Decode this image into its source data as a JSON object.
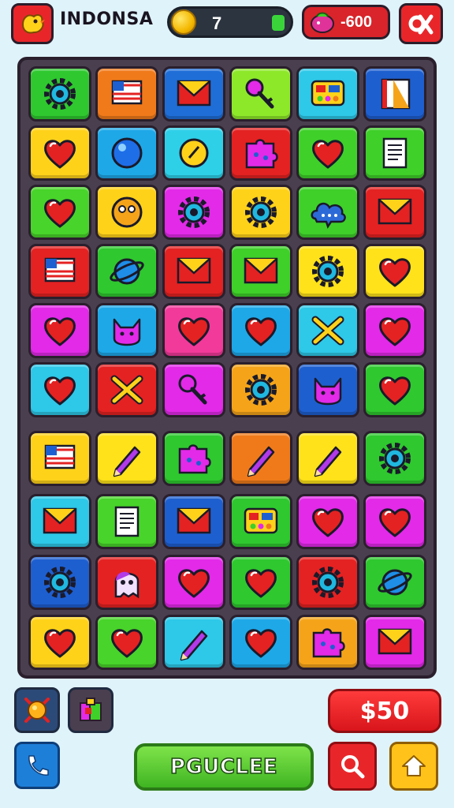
{
  "header": {
    "title": "INDONSA",
    "coins": "7",
    "cash": "-600",
    "logo_icon": "bird-icon",
    "close_icon": "close-icon"
  },
  "board": {
    "rows": [
      [
        {
          "color": "#2fc82f",
          "icon": "gear"
        },
        {
          "color": "#f07a1a",
          "icon": "flag"
        },
        {
          "color": "#1f6ed8",
          "icon": "envelope"
        },
        {
          "color": "#8ee82a",
          "icon": "key"
        },
        {
          "color": "#2ec8e8",
          "icon": "palette"
        },
        {
          "color": "#1e5fd0",
          "icon": "flag-stripe"
        }
      ],
      [
        {
          "color": "#ffd21a",
          "icon": "heart"
        },
        {
          "color": "#1ea8e8",
          "icon": "ball"
        },
        {
          "color": "#2ed0e8",
          "icon": "coin"
        },
        {
          "color": "#e42222",
          "icon": "puzzle"
        },
        {
          "color": "#3fd02a",
          "icon": "heart"
        },
        {
          "color": "#3fd02a",
          "icon": "document"
        }
      ],
      [
        {
          "color": "#48d42a",
          "icon": "heart"
        },
        {
          "color": "#ffd21a",
          "icon": "face"
        },
        {
          "color": "#e22ae8",
          "icon": "gear"
        },
        {
          "color": "#ffd21a",
          "icon": "gear"
        },
        {
          "color": "#3fd02a",
          "icon": "cloud"
        },
        {
          "color": "#e42222",
          "icon": "envelope"
        }
      ],
      [
        {
          "color": "#e42222",
          "icon": "flag"
        },
        {
          "color": "#2fc82f",
          "icon": "planet"
        },
        {
          "color": "#e42222",
          "icon": "envelope"
        },
        {
          "color": "#3fd02a",
          "icon": "envelope"
        },
        {
          "color": "#ffe21a",
          "icon": "gear"
        },
        {
          "color": "#ffe21a",
          "icon": "heart"
        }
      ],
      [
        {
          "color": "#e22ae8",
          "icon": "heart"
        },
        {
          "color": "#1ea8e8",
          "icon": "cat"
        },
        {
          "color": "#f23a9a",
          "icon": "heart"
        },
        {
          "color": "#1ea8e8",
          "icon": "heart"
        },
        {
          "color": "#2ec8e8",
          "icon": "cross"
        },
        {
          "color": "#e22ae8",
          "icon": "heart"
        }
      ],
      [
        {
          "color": "#2ec8e8",
          "icon": "heart"
        },
        {
          "color": "#e42222",
          "icon": "cross"
        },
        {
          "color": "#e22ae8",
          "icon": "key"
        },
        {
          "color": "#f5a41a",
          "icon": "gear"
        },
        {
          "color": "#1e5fd0",
          "icon": "cat"
        },
        {
          "color": "#2fc82f",
          "icon": "heart"
        }
      ],
      [
        {
          "color": "#ffd21a",
          "icon": "flag"
        },
        {
          "color": "#ffe21a",
          "icon": "pencil"
        },
        {
          "color": "#2fc82f",
          "icon": "puzzle"
        },
        {
          "color": "#f07a1a",
          "icon": "pencil"
        },
        {
          "color": "#ffe21a",
          "icon": "pencil"
        },
        {
          "color": "#2fc82f",
          "icon": "gear"
        }
      ],
      [
        {
          "color": "#2ec8e8",
          "icon": "envelope"
        },
        {
          "color": "#48d42a",
          "icon": "document"
        },
        {
          "color": "#1e5fd0",
          "icon": "envelope"
        },
        {
          "color": "#2fc82f",
          "icon": "palette"
        },
        {
          "color": "#e22ae8",
          "icon": "heart"
        },
        {
          "color": "#e22ae8",
          "icon": "heart"
        }
      ],
      [
        {
          "color": "#1e5fd0",
          "icon": "gear"
        },
        {
          "color": "#e42222",
          "icon": "ghost"
        },
        {
          "color": "#e22ae8",
          "icon": "heart"
        },
        {
          "color": "#2fc82f",
          "icon": "heart"
        },
        {
          "color": "#e42222",
          "icon": "gear"
        },
        {
          "color": "#2fc82f",
          "icon": "planet"
        }
      ],
      [
        {
          "color": "#ffd21a",
          "icon": "heart"
        },
        {
          "color": "#48d42a",
          "icon": "heart"
        },
        {
          "color": "#2ec8e8",
          "icon": "pencil"
        },
        {
          "color": "#1ea8e8",
          "icon": "heart"
        },
        {
          "color": "#f5a41a",
          "icon": "puzzle"
        },
        {
          "color": "#e22ae8",
          "icon": "envelope"
        }
      ]
    ]
  },
  "controls": {
    "price_label": "$50",
    "play_label": "PGUCLEE",
    "bomb_icon": "bomb-icon",
    "puzzle_icon": "puzzle-piece-icon",
    "phone_icon": "phone-icon",
    "search_icon": "search-icon",
    "home_icon": "home-icon"
  }
}
